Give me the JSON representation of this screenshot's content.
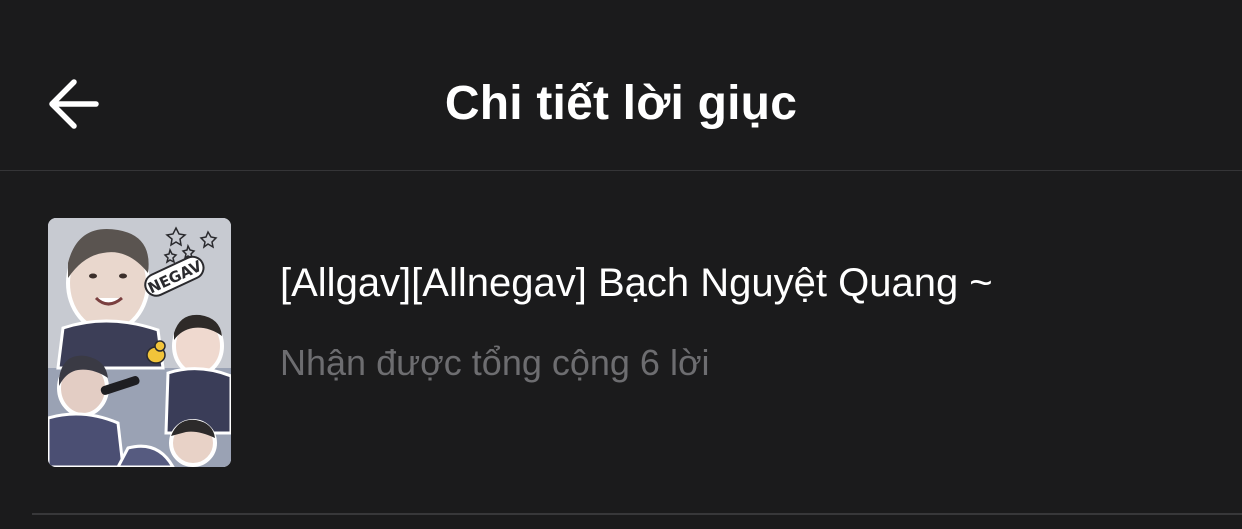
{
  "header": {
    "title": "Chi tiết lời giục",
    "back_icon": "arrow-left-icon"
  },
  "story": {
    "title": "[Allgav][Allnegav] Bạch Nguyệt Quang ~",
    "subtitle": "Nhận được tổng cộng 6 lời",
    "cover_sticker_text": "NEGAV"
  },
  "colors": {
    "background": "#1b1b1c",
    "title_text": "#ffffff",
    "subtitle_text": "#6d6d70",
    "divider": "#38383a"
  }
}
